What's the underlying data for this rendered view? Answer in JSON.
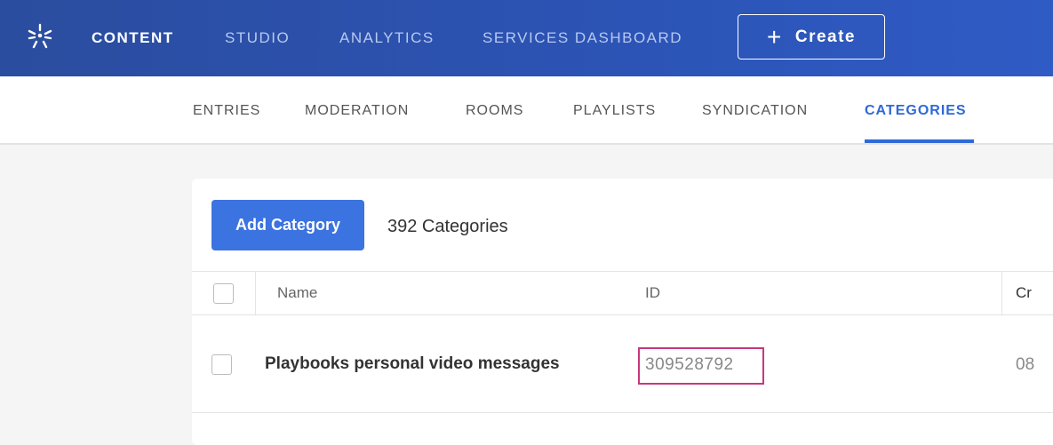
{
  "topnav": {
    "items": [
      {
        "label": "CONTENT",
        "active": true
      },
      {
        "label": "STUDIO",
        "active": false
      },
      {
        "label": "ANALYTICS",
        "active": false
      },
      {
        "label": "SERVICES DASHBOARD",
        "active": false
      }
    ],
    "create_label": "Create",
    "create_icon": "plus-icon",
    "logo_icon": "kaltura-logo-icon"
  },
  "subnav": {
    "items": [
      {
        "label": "ENTRIES",
        "active": false
      },
      {
        "label": "MODERATION",
        "active": false
      },
      {
        "label": "ROOMS",
        "active": false
      },
      {
        "label": "PLAYLISTS",
        "active": false
      },
      {
        "label": "SYNDICATION",
        "active": false
      },
      {
        "label": "CATEGORIES",
        "active": true
      }
    ]
  },
  "categories": {
    "add_label": "Add Category",
    "count_label": "392 Categories",
    "columns": [
      "Name",
      "ID",
      "Cr"
    ],
    "rows": [
      {
        "name": "Playbooks personal video messages",
        "id": "309528792",
        "created": "08"
      }
    ]
  },
  "colors": {
    "topbar": "#2c54b6",
    "accent": "#2e69d6",
    "button": "#3b73e0",
    "highlight_border": "#c9367e"
  }
}
